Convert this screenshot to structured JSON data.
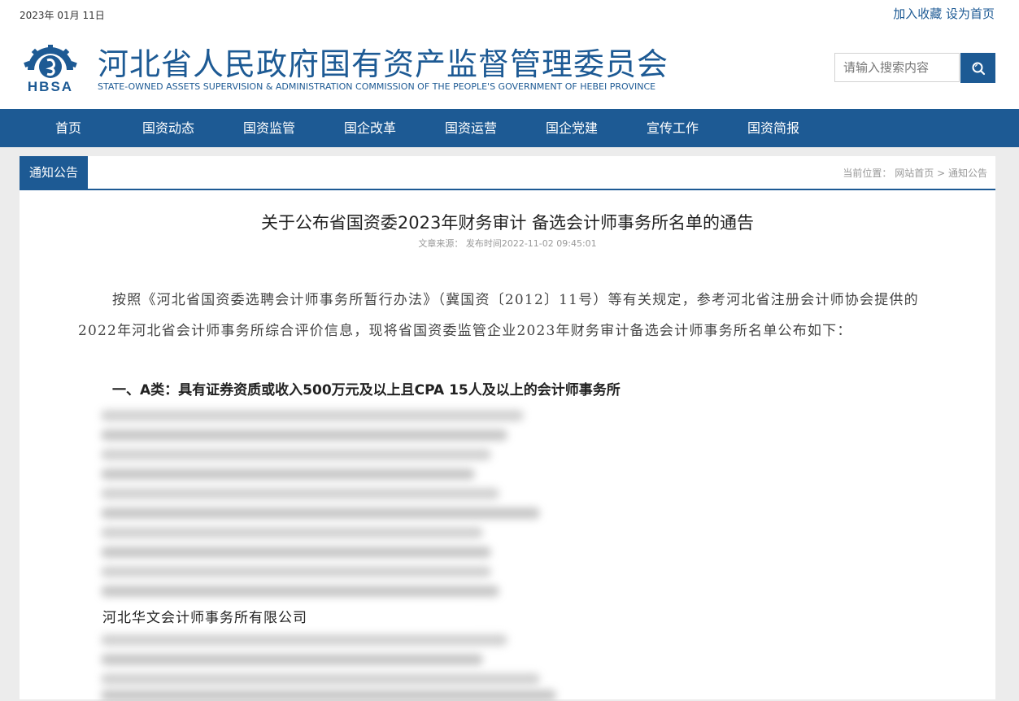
{
  "header": {
    "date": "2023年 01月 11日",
    "links": [
      "加入收藏",
      "设为首页"
    ],
    "logo_text": "HBSA",
    "title": "河北省人民政府国有资产监督管理委员会",
    "subtitle": "STATE-OWNED ASSETS SUPERVISION & ADMINISTRATION COMMISSION OF THE PEOPLE'S GOVERNMENT OF HEBEI PROVINCE",
    "search_placeholder": "请输入搜索内容"
  },
  "nav": [
    "首页",
    "国资动态",
    "国资监管",
    "国企改革",
    "国资运营",
    "国企党建",
    "宣传工作",
    "国资简报"
  ],
  "panel": {
    "tab": "通知公告",
    "breadcrumb_label": "当前位置：",
    "breadcrumb_home": "网站首页",
    "breadcrumb_sep": ">",
    "breadcrumb_current": "通知公告"
  },
  "article": {
    "title": "关于公布省国资委2023年财务审计 备选会计师事务所名单的通告",
    "meta": "文章来源： 发布时间2022-11-02 09:45:01",
    "paragraph": "按照《河北省国资委选聘会计师事务所暂行办法》（冀国资〔2012〕11号）等有关规定，参考河北省注册会计师协会提供的2022年河北省会计师事务所综合评价信息，现将省国资委监管企业2023年财务审计备选会计师事务所名单公布如下：",
    "section_heading": "一、A类：具有证券资质或收入500万元及以上且CPA 15人及以上的会计师事务所",
    "visible_entry": "河北华文会计师事务所有限公司"
  },
  "colors": {
    "brand_blue": "#1d5a94",
    "page_bg": "#ececec"
  },
  "icons": {
    "search": "search-icon",
    "logo": "hbsa-logo-icon"
  }
}
